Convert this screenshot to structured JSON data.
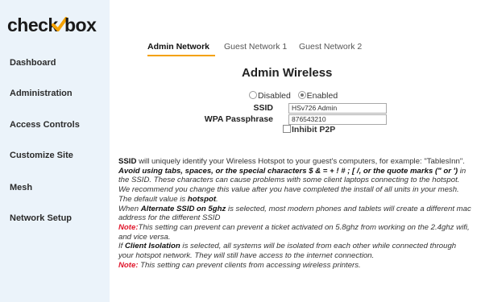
{
  "brand": {
    "logo_left": "check",
    "logo_right": "box",
    "accent": "#f4a100"
  },
  "sidebar": {
    "items": [
      {
        "label": "Dashboard"
      },
      {
        "label": "Administration"
      },
      {
        "label": "Access Controls"
      },
      {
        "label": "Customize Site"
      },
      {
        "label": "Mesh"
      },
      {
        "label": "Network Setup"
      }
    ]
  },
  "tabs": [
    {
      "label": "Admin Network",
      "active": true
    },
    {
      "label": "Guest Network 1",
      "active": false
    },
    {
      "label": "Guest Network 2",
      "active": false
    }
  ],
  "section_title": "Admin Wireless",
  "wireless_state": {
    "disabled_label": "Disabled",
    "enabled_label": "Enabled",
    "selected": "Enabled"
  },
  "form": {
    "ssid_label": "SSID",
    "ssid_value": "HSv726 Admin",
    "passphrase_label": "WPA Passphrase",
    "passphrase_value": "876543210",
    "inhibit_label": "Inhibit P2P",
    "inhibit_checked": false
  },
  "help": {
    "p1_ssid": "SSID",
    "p1_text": " will uniquely identify your Wireless Hotspot to your guest's computers, for example: \"TablesInn\".",
    "p2_bold": "Avoid using tabs, spaces, or the special characters $ & = + ! # ; [ /, or the quote marks (\" or ')",
    "p2_text": " in the SSID. These characters can cause problems with some client laptops connecting to the hotspot. We recommend you change this value after you have completed the install of all units in your mesh. The default value is ",
    "p2_default": "hotspot",
    "p2_end": ".",
    "p3_pre": "When ",
    "p3_bold": "Alternate SSID on 5ghz",
    "p3_text": " is selected, most modern phones and tablets will create a different mac address for the different SSID",
    "p4_note": "Note:",
    "p4_text": "This setting can prevent can prevent a ticket activated on 5.8ghz from working on the 2.4ghz wifi, and vice versa.",
    "p5_pre": "If ",
    "p5_bold": "Client Isolation",
    "p5_text": " is selected, all systems will be isolated from each other while connected through your hotspot network. They will still have access to the internet connection.",
    "p6_note": "Note:",
    "p6_text": " This setting can prevent clients from accessing wireless printers."
  }
}
